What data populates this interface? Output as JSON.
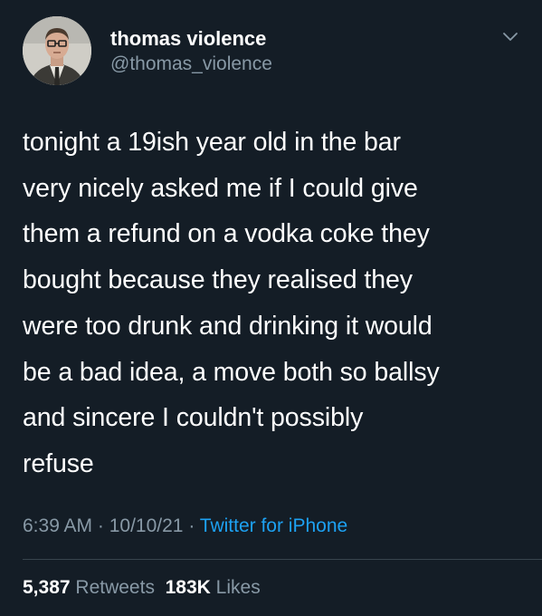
{
  "author": {
    "display_name": "thomas violence",
    "handle": "@thomas_violence",
    "avatar": "avatar-man-in-glasses-and-tie"
  },
  "menu_icon": "chevron-down-icon",
  "tweet": {
    "lines": [
      "tonight a 19ish year old in the bar",
      "very nicely asked me if I could give",
      "them a refund on a vodka coke they",
      "bought because they realised they",
      "were too drunk and drinking it would",
      "be a bad idea, a move both so ballsy",
      "and sincere I couldn't possibly",
      "refuse"
    ]
  },
  "meta": {
    "time": "6:39 AM",
    "separator": " · ",
    "date": "10/10/21",
    "source": "Twitter for iPhone"
  },
  "stats": {
    "retweets_count": "5,387",
    "retweets_label": "Retweets",
    "likes_count": "183K",
    "likes_label": "Likes"
  },
  "colors": {
    "background": "#141d26",
    "text": "#ffffff",
    "secondary": "#8899a6",
    "accent": "#1da1f2",
    "divider": "#38444d"
  }
}
